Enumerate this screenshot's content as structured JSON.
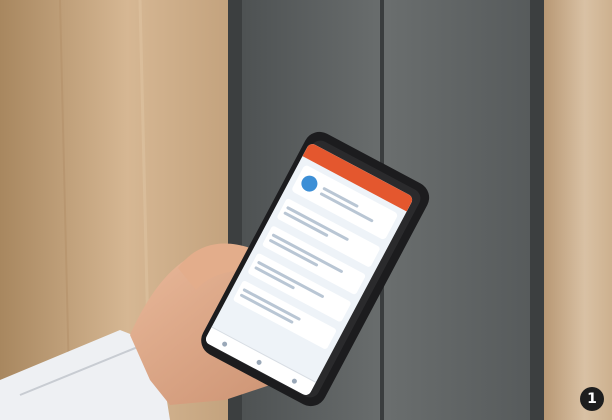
{
  "photo": {
    "badge_number": "1",
    "colors": {
      "wall": "#c9a77e",
      "elevator_door": "#5b5f60",
      "phone_body": "#1c1c1e",
      "screen_header": "#e4572e",
      "screen_bg": "#eef3f8"
    },
    "icons": [
      "avatar-icon",
      "tab-home-icon",
      "tab-list-icon",
      "tab-profile-icon"
    ]
  }
}
